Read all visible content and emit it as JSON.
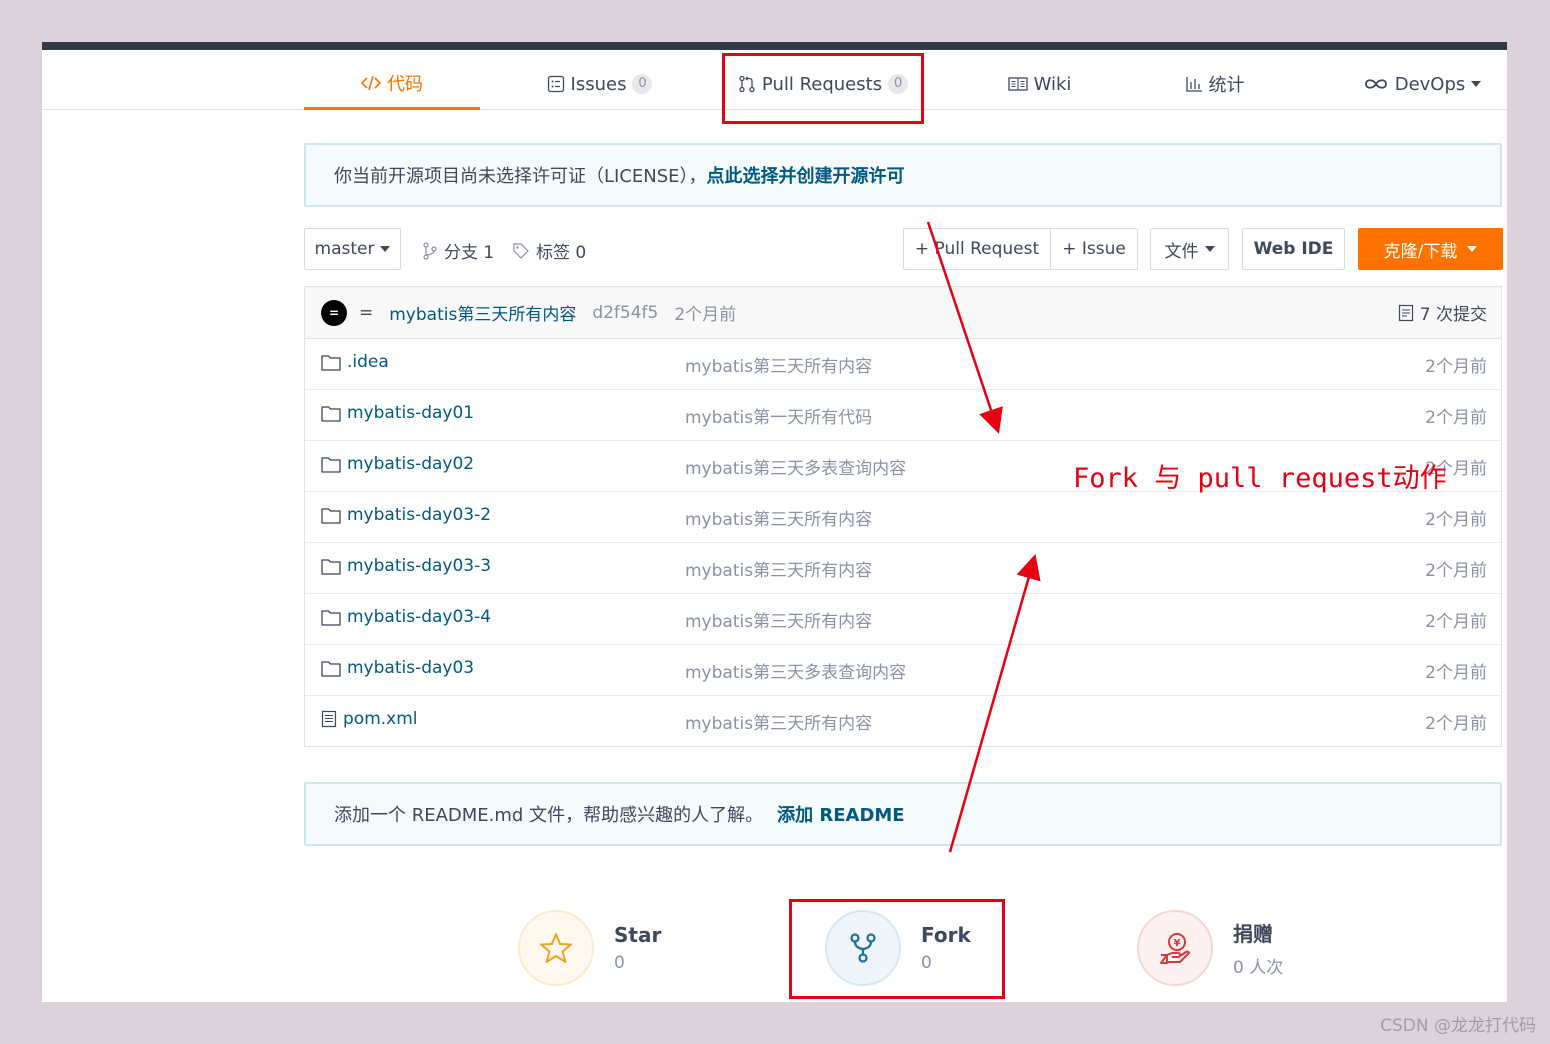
{
  "tabs": {
    "code": "代码",
    "issues": "Issues",
    "issues_count": "0",
    "pull_requests": "Pull Requests",
    "pull_requests_count": "0",
    "wiki": "Wiki",
    "stats": "统计",
    "devops": "DevOps"
  },
  "license_notice": {
    "text": "你当前开源项目尚未选择许可证（LICENSE），",
    "link": "点此选择并创建开源许可"
  },
  "toolbar": {
    "branch": "master",
    "branches": "分支 1",
    "tags": "标签 0",
    "new_pull_request": "+ Pull Request",
    "new_issue": "+ Issue",
    "files": "文件",
    "web_ide": "Web IDE",
    "clone": "克隆/下载"
  },
  "latest_commit": {
    "avatar": "=",
    "author": "=",
    "message": "mybatis第三天所有内容",
    "hash": "d2f54f5",
    "time": "2个月前",
    "commits": "7 次提交"
  },
  "files": [
    {
      "name": ".idea",
      "type": "folder",
      "message": "mybatis第三天所有内容",
      "time": "2个月前"
    },
    {
      "name": "mybatis-day01",
      "type": "folder",
      "message": "mybatis第一天所有代码",
      "time": "2个月前"
    },
    {
      "name": "mybatis-day02",
      "type": "folder",
      "message": "mybatis第三天多表查询内容",
      "time": "2个月前"
    },
    {
      "name": "mybatis-day03-2",
      "type": "folder",
      "message": "mybatis第三天所有内容",
      "time": "2个月前"
    },
    {
      "name": "mybatis-day03-3",
      "type": "folder",
      "message": "mybatis第三天所有内容",
      "time": "2个月前"
    },
    {
      "name": "mybatis-day03-4",
      "type": "folder",
      "message": "mybatis第三天所有内容",
      "time": "2个月前"
    },
    {
      "name": "mybatis-day03",
      "type": "folder",
      "message": "mybatis第三天多表查询内容",
      "time": "2个月前"
    },
    {
      "name": "pom.xml",
      "type": "file",
      "message": "mybatis第三天所有内容",
      "time": "2个月前"
    }
  ],
  "readme_notice": {
    "text": "添加一个 README.md 文件，帮助感兴趣的人了解。",
    "link": "添加 README"
  },
  "stats": {
    "star_label": "Star",
    "star_count": "0",
    "fork_label": "Fork",
    "fork_count": "0",
    "donate_label": "捐赠",
    "donate_count": "0 人次"
  },
  "annotation": "Fork 与 pull request动作",
  "watermark": "CSDN @龙龙打代码",
  "colors": {
    "accent": "#fe7300",
    "link": "#005980",
    "annotation_red": "#e60012"
  }
}
